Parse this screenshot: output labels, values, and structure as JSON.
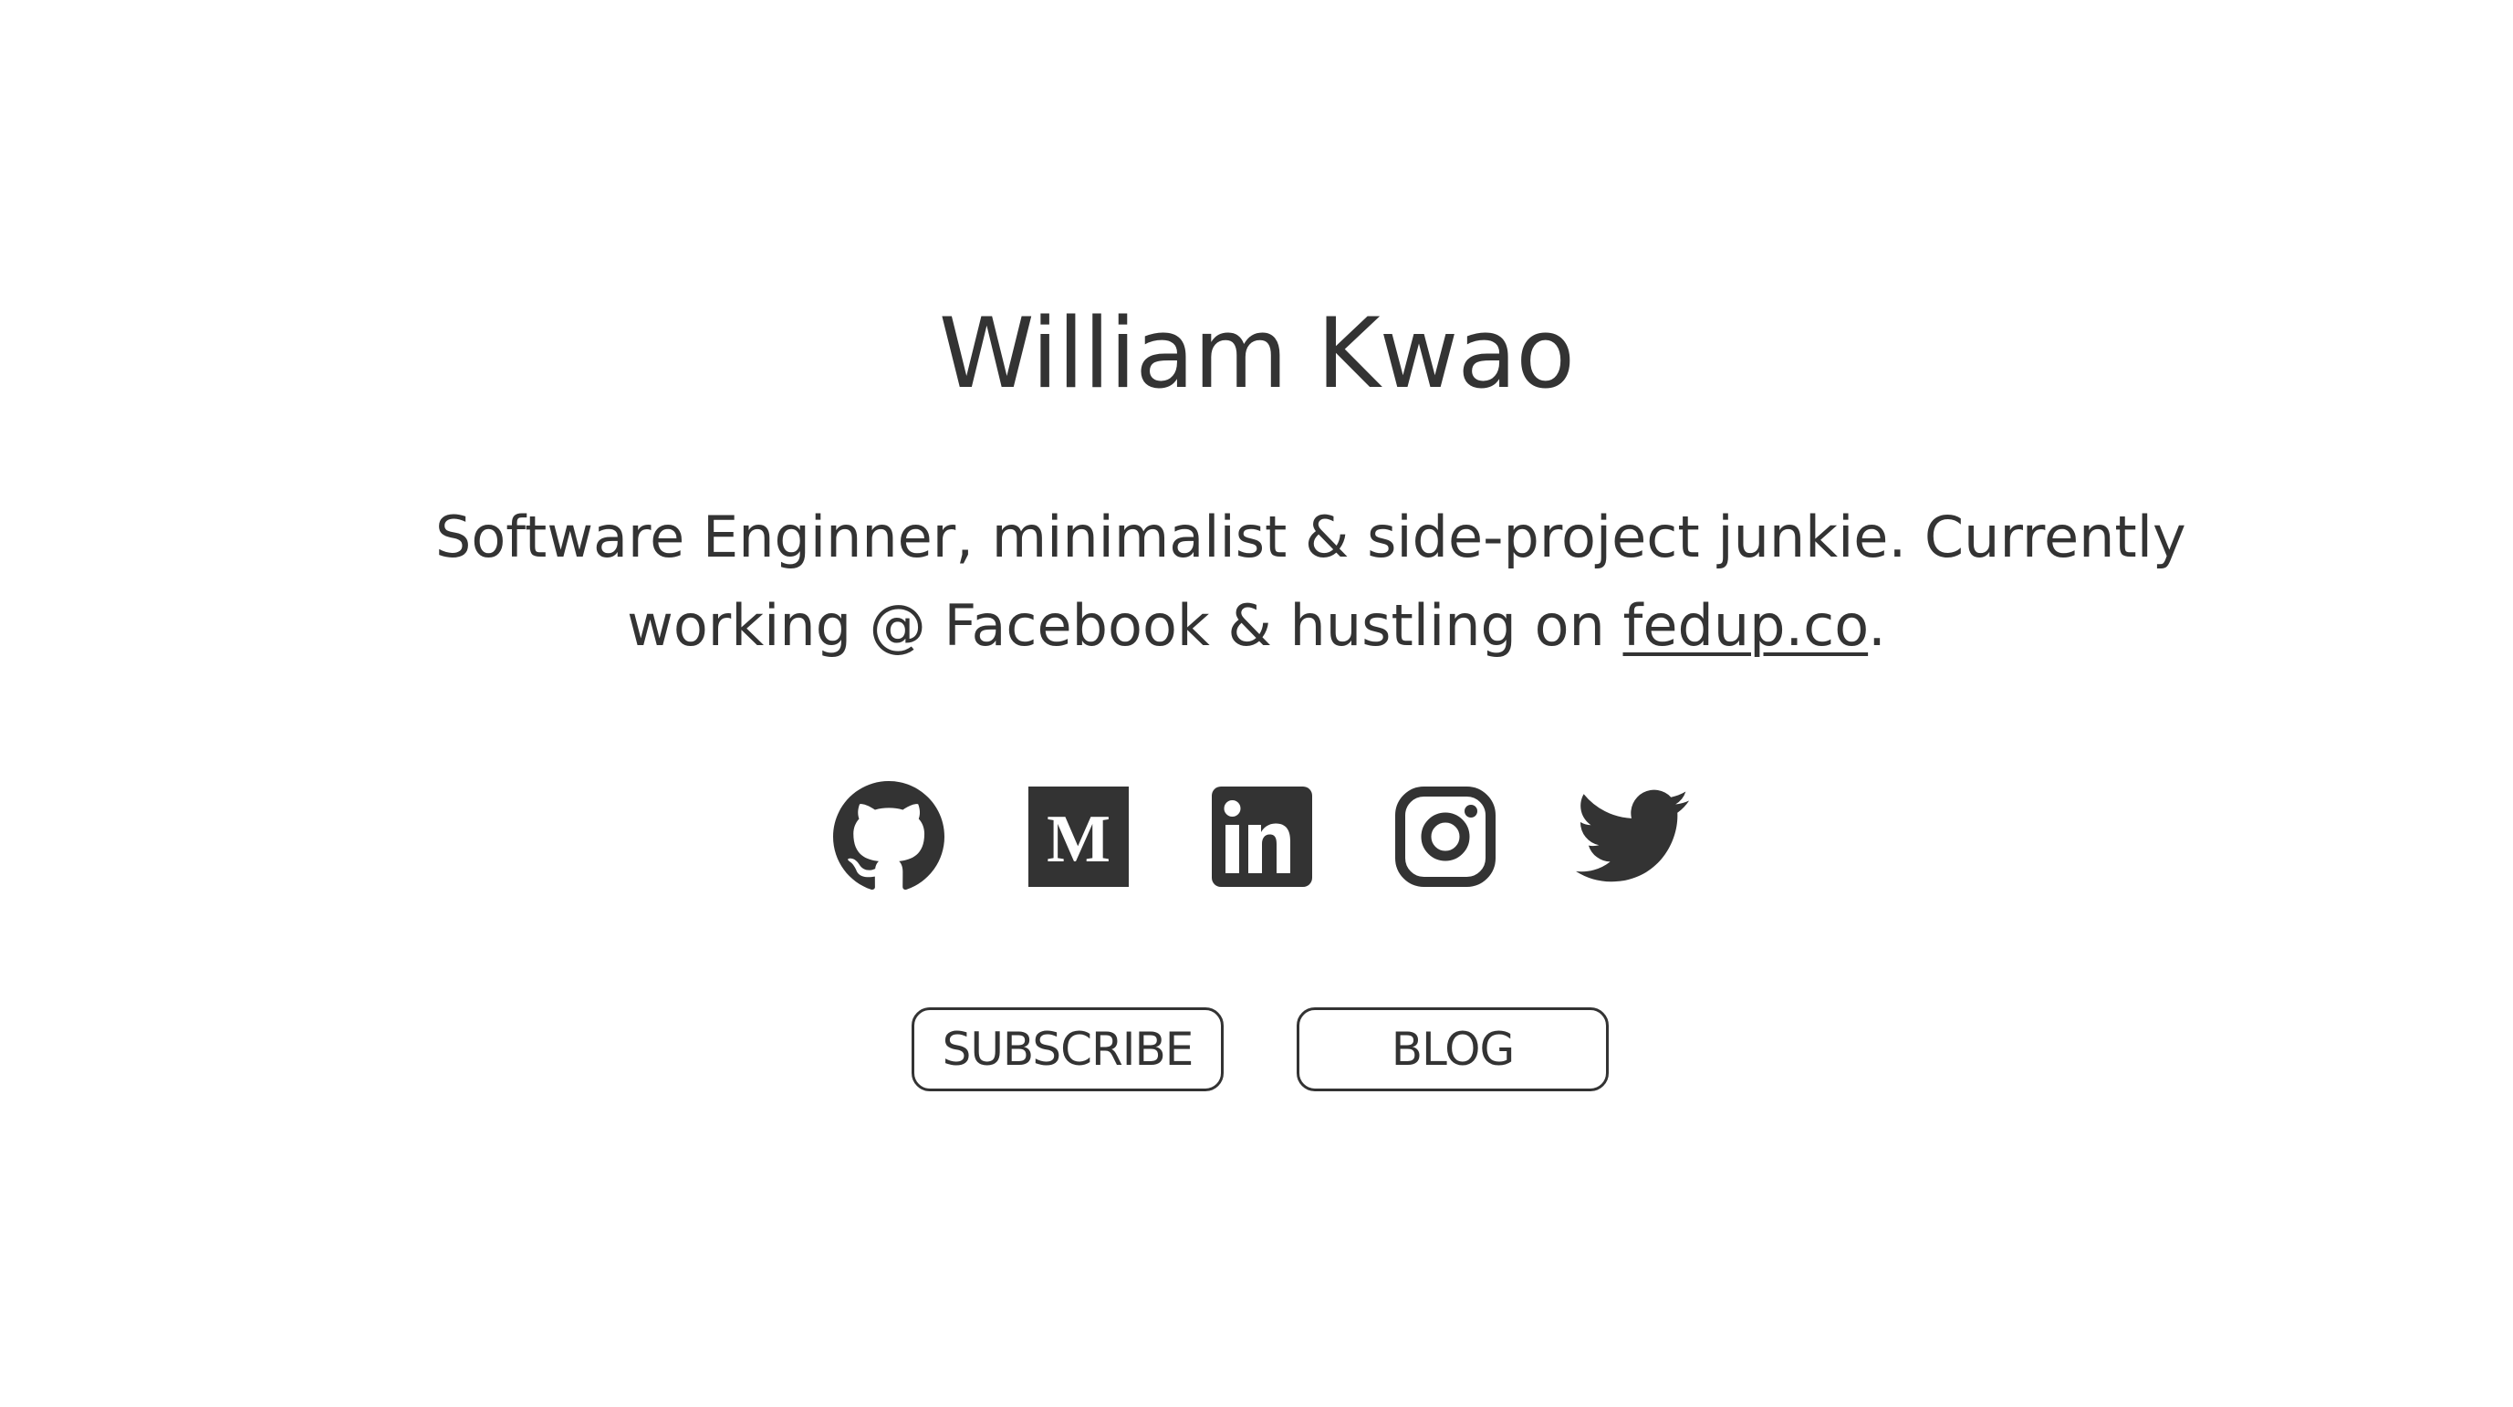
{
  "profile": {
    "name": "William Kwao",
    "bio_line1": "Software Enginner, minimalist & side-project junkie. Currently",
    "bio_line2_prefix": "working @ Facebook & hustling on ",
    "bio_link_text": "fedup.co",
    "bio_line2_suffix": "."
  },
  "socials": [
    {
      "name": "github-icon"
    },
    {
      "name": "medium-icon"
    },
    {
      "name": "linkedin-icon"
    },
    {
      "name": "instagram-icon"
    },
    {
      "name": "twitter-icon"
    }
  ],
  "buttons": {
    "subscribe_label": "SUBSCRIBE",
    "blog_label": "BLOG"
  },
  "colors": {
    "text": "#333333",
    "background": "#ffffff"
  }
}
